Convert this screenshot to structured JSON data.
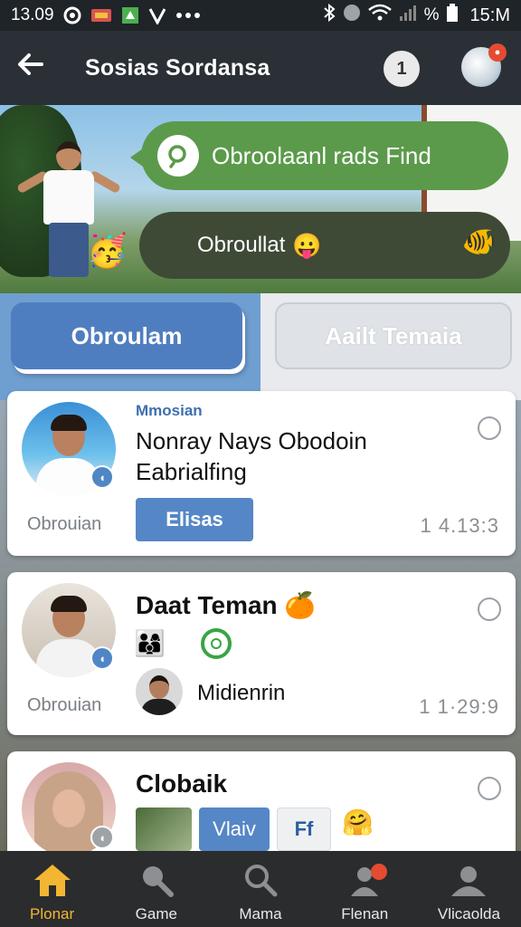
{
  "status_bar": {
    "time": "13.09",
    "percent": "%",
    "time_right": "15:M"
  },
  "header": {
    "title": "Sosias Sordansa",
    "sync_label": "1"
  },
  "hero": {
    "search_text": "Obroolaanl rads Find",
    "chat_text": "Obroullat"
  },
  "tabs": {
    "active_label": "Obroulam",
    "inactive_label": "Aailt Temaia"
  },
  "cards": [
    {
      "category": "Mmosian",
      "name_line1": "Nonray Nays Obodoin",
      "name_line2": "Eabrialfing",
      "left_label": "Obrouian",
      "button_label": "Elisas",
      "meta": "1 4.13:3"
    },
    {
      "name": "Daat Teman",
      "left_label": "Obrouian",
      "sub_name": "Midienrin",
      "meta": "1 1·29:9"
    },
    {
      "name": "Clobaik",
      "button_label": "Vlaiv",
      "button2_label": "Ff"
    }
  ],
  "bottom_nav": [
    {
      "label": "Plonar",
      "icon": "home-icon",
      "active": true
    },
    {
      "label": "Game",
      "icon": "search-icon",
      "active": false
    },
    {
      "label": "Mama",
      "icon": "search-icon",
      "active": false
    },
    {
      "label": "Flenan",
      "icon": "user-notify-icon",
      "active": false
    },
    {
      "label": "Vlicaolda",
      "icon": "user-icon",
      "active": false
    }
  ],
  "colors": {
    "accent_blue": "#4f7ec0",
    "search_green": "#5b9a4a",
    "nav_active": "#f2b632",
    "header_bg": "#2a3036"
  }
}
